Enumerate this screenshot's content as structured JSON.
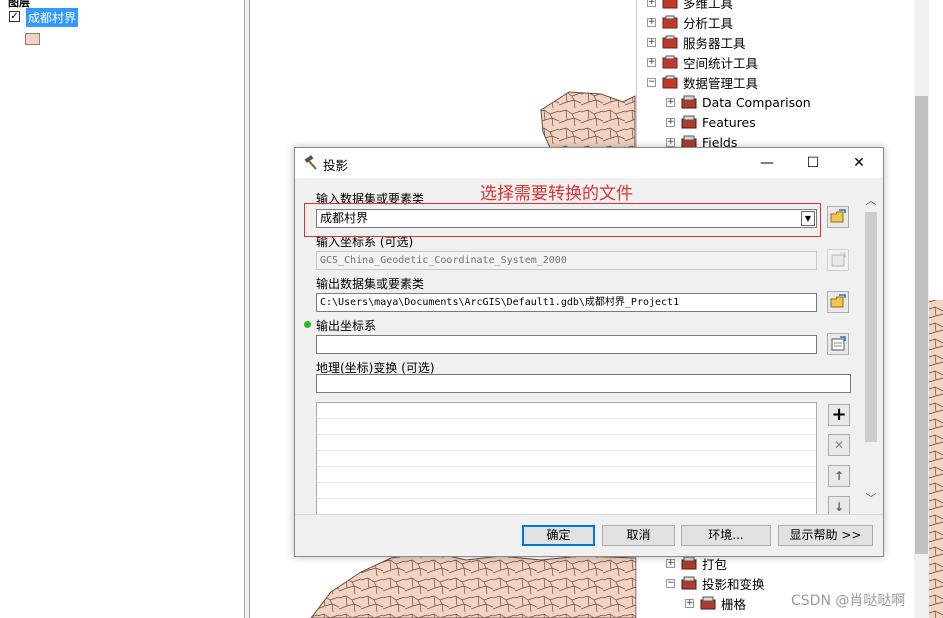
{
  "toc": {
    "layer_name": "成都村界",
    "layer_checked": "✓"
  },
  "toolbox": {
    "items_top": [
      {
        "label": "多维工具",
        "expander": "+"
      },
      {
        "label": "分析工具",
        "expander": "+"
      },
      {
        "label": "服务器工具",
        "expander": "+"
      },
      {
        "label": "空间统计工具",
        "expander": "+"
      },
      {
        "label": "数据管理工具",
        "expander": "−"
      },
      {
        "label": "Data Comparison",
        "expander": "+"
      },
      {
        "label": "Features",
        "expander": "+"
      },
      {
        "label": "Fields",
        "expander": "+"
      }
    ],
    "items_bottom": [
      {
        "label": "打包",
        "expander": "+"
      },
      {
        "label": "投影和变换",
        "expander": "−"
      },
      {
        "label": "栅格",
        "expander": "+"
      }
    ]
  },
  "dialog": {
    "title": "投影",
    "minimize": "—",
    "maximize": "☐",
    "close": "✕",
    "input_label": "输入数据集或要素类",
    "input_value": "成都村界",
    "input_coord_label": "输入坐标系 (可选)",
    "input_coord_value": "GCS_China_Geodetic_Coordinate_System_2000",
    "output_label": "输出数据集或要素类",
    "output_value": "C:\\Users\\maya\\Documents\\ArcGIS\\Default1.gdb\\成都村界_Project1",
    "output_coord_label": "输出坐标系",
    "output_coord_value": "",
    "geo_transform_label": "地理(坐标)变换 (可选)",
    "geo_transform_value": "",
    "buttons": {
      "ok": "确定",
      "cancel": "取消",
      "env": "环境...",
      "help": "显示帮助 >>"
    },
    "side_buttons": {
      "add": "+",
      "remove": "✕",
      "up": "↑",
      "down": "↓"
    }
  },
  "annotation": {
    "text": "选择需要转换的文件",
    "color": "#e03030"
  },
  "watermark": "CSDN @肖哒哒啊",
  "colors": {
    "selection": "#3399ff",
    "polygon_fill": "#f2d2c1",
    "polygon_stroke": "#6b4a3e",
    "required_dot": "#22bb22"
  }
}
